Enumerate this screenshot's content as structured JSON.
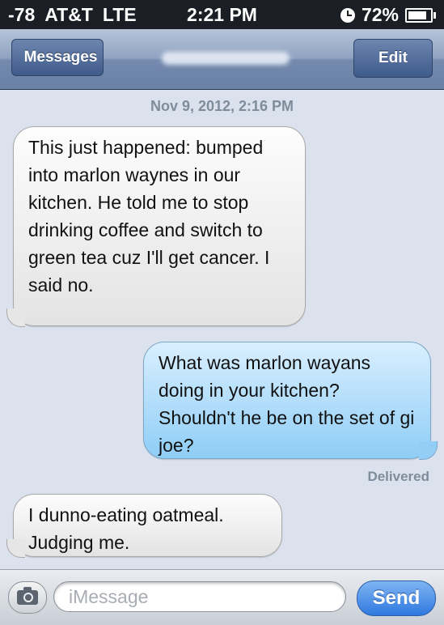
{
  "status_bar": {
    "signal": "-78",
    "carrier": "AT&T",
    "network": "LTE",
    "time": "2:21 PM",
    "battery": "72%",
    "battery_level": 0.72
  },
  "nav": {
    "back_label": "Messages",
    "edit_label": "Edit"
  },
  "thread": {
    "timestamp": "Nov 9, 2012, 2:16 PM",
    "messages": [
      {
        "direction": "incoming",
        "text": "This just happened: bumped into marlon waynes in our kitchen. He told me to stop drinking coffee and switch to green tea cuz I'll get cancer. I said no."
      },
      {
        "direction": "outgoing",
        "text": "What was marlon wayans doing in your kitchen? Shouldn't he be on the set of gi joe?"
      },
      {
        "direction": "incoming",
        "text": "I dunno-eating oatmeal. Judging me."
      }
    ],
    "delivered_label": "Delivered"
  },
  "composer": {
    "placeholder": "iMessage",
    "send_label": "Send"
  },
  "colors": {
    "incoming_bubble": "#e9e9e9",
    "outgoing_bubble": "#9fd3f7",
    "send_button": "#3a82e4",
    "nav_bar": "#7f94b7"
  }
}
